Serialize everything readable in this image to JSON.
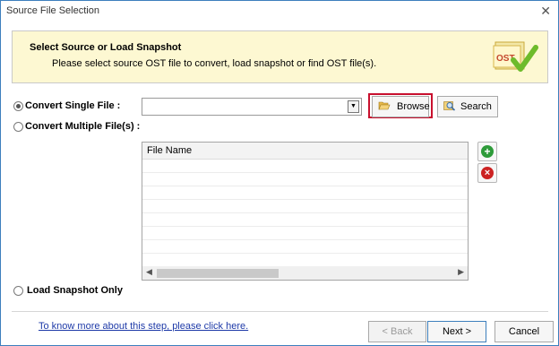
{
  "window": {
    "title": "Source File Selection",
    "close": "✕"
  },
  "header": {
    "title": "Select Source or Load Snapshot",
    "subtitle": "Please select source OST file to convert, load snapshot or find OST file(s).",
    "logo_text": "OST"
  },
  "options": {
    "single": {
      "label": "Convert Single File :",
      "selected": true
    },
    "multiple": {
      "label": "Convert Multiple File(s) :",
      "selected": false
    },
    "snapshot": {
      "label": "Load Snapshot Only",
      "selected": false
    }
  },
  "single_file": {
    "value": ""
  },
  "buttons": {
    "browse": "Browse",
    "search": "Search",
    "back": "< Back",
    "next": "Next >",
    "cancel": "Cancel"
  },
  "file_list": {
    "column_header": "File Name",
    "rows": []
  },
  "footer": {
    "help_link": "To know more about this step, please click here."
  },
  "colors": {
    "highlight": "#c8102e",
    "header_bg": "#fdf8d2",
    "add": "#2e9b3a",
    "remove": "#cc2222",
    "link": "#1e3aa8"
  }
}
